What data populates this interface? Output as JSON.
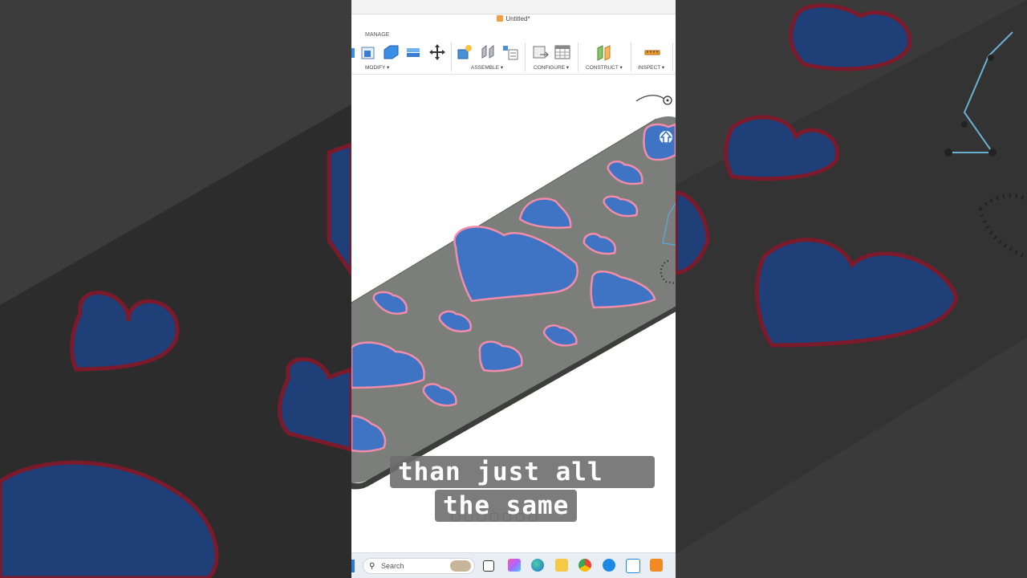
{
  "window": {
    "title": "Untitled*"
  },
  "toolbar": {
    "tab_label": "MANAGE",
    "groups": [
      {
        "label": "MODIFY ▾"
      },
      {
        "label": "ASSEMBLE ▾"
      },
      {
        "label": "CONFIGURE ▾"
      },
      {
        "label": "CONSTRUCT ▾"
      },
      {
        "label": "INSPECT ▾"
      }
    ]
  },
  "captions": {
    "line1": "than just all",
    "line2": "the same"
  },
  "taskbar": {
    "search_placeholder": "Search"
  },
  "colors": {
    "plate": "#7a7d7a",
    "heart_fill": "#3f74c4",
    "heart_outline": "#f28ca8",
    "caption_bg": "#6e6e6e",
    "fusion_orange": "#f08a24"
  }
}
